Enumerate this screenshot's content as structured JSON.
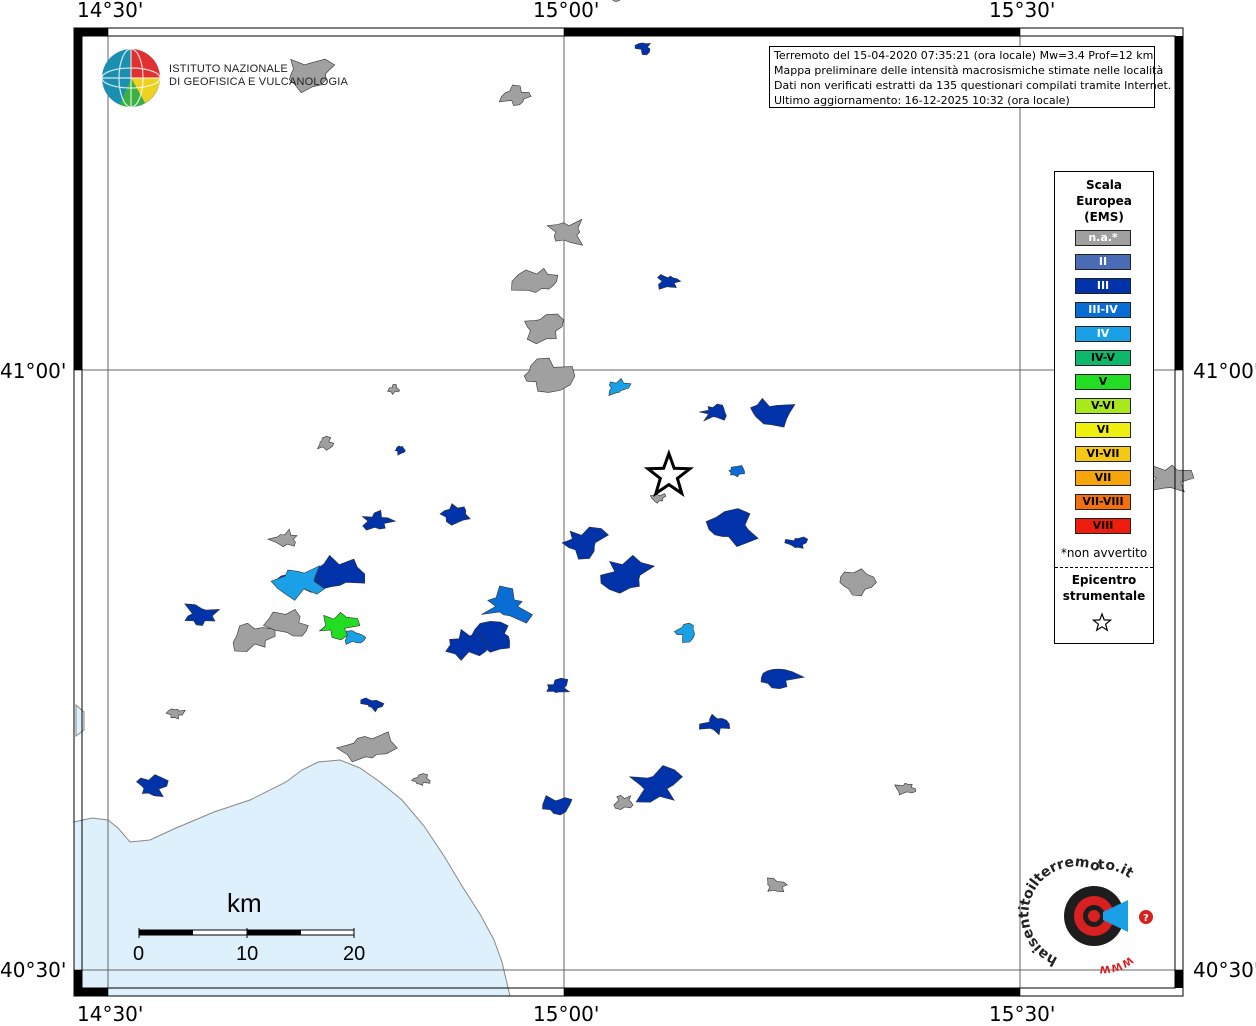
{
  "info": {
    "line1": "Terremoto del 15-04-2020 07:35:21 (ora locale) Mw=3.4 Prof=12 km",
    "line2": "Mappa preliminare delle intensità macrosismiche stimate nelle località",
    "line3": "Dati non verificati estratti da 135 questionari compilati tramite Internet.",
    "line4": "Ultimo aggiornamento: 16-12-2025 10:32 (ora locale)"
  },
  "axes": {
    "lon_labels": [
      "14°30'",
      "15°00'",
      "15°30'"
    ],
    "lat_labels": [
      "41°00'",
      "40°30'"
    ]
  },
  "legend": {
    "title_1": "Scala",
    "title_2": "Europea",
    "title_3": "(EMS)",
    "classes": [
      {
        "label": "n.a.*",
        "color": "#a0a0a0",
        "text_color": "#ffffff"
      },
      {
        "label": "II",
        "color": "#4a6bb5",
        "text_color": "#ffffff"
      },
      {
        "label": "III",
        "color": "#0033aa",
        "text_color": "#ffffff"
      },
      {
        "label": "III-IV",
        "color": "#0a6dd6",
        "text_color": "#ffffff"
      },
      {
        "label": "IV",
        "color": "#1aa0e6",
        "text_color": "#ffffff"
      },
      {
        "label": "IV-V",
        "color": "#0db86a",
        "text_color": "#000000"
      },
      {
        "label": "V",
        "color": "#22dd22",
        "text_color": "#000000"
      },
      {
        "label": "V-VI",
        "color": "#a8e81c",
        "text_color": "#000000"
      },
      {
        "label": "VI",
        "color": "#f0f010",
        "text_color": "#000000"
      },
      {
        "label": "VI-VII",
        "color": "#f5c816",
        "text_color": "#000000"
      },
      {
        "label": "VII",
        "color": "#f6a50c",
        "text_color": "#000000"
      },
      {
        "label": "VII-VIII",
        "color": "#f2700e",
        "text_color": "#000000"
      },
      {
        "label": "VIII",
        "color": "#ee1c0c",
        "text_color": "#000000"
      }
    ],
    "note": "*non avvertito",
    "epicenter_1": "Epicentro",
    "epicenter_2": "strumentale"
  },
  "logo": {
    "line1": "ISTITUTO NAZIONALE",
    "line2": "DI GEOFISICA E VULCANOLOGIA"
  },
  "scale_bar": {
    "unit": "km",
    "ticks": [
      "0",
      "10",
      "20"
    ]
  },
  "hsit_logo": {
    "text": "haisentitoilterremoto.it",
    "url": "WWW."
  },
  "colors": {
    "sea": "#ddf0fb",
    "frame": "#000000",
    "grid": "#555555"
  },
  "localities": [
    {
      "cls": 0,
      "lon": 14.948,
      "lat": 41.228
    },
    {
      "cls": 0,
      "lon": 15.054,
      "lat": 41.312
    },
    {
      "cls": 0,
      "lon": 15.003,
      "lat": 41.115
    },
    {
      "cls": 0,
      "lon": 14.976,
      "lat": 41.036
    },
    {
      "cls": 0,
      "lon": 14.719,
      "lat": 41.247
    },
    {
      "cls": 0,
      "lon": 14.977,
      "lat": 40.995
    },
    {
      "cls": 0,
      "lon": 14.814,
      "lat": 40.984
    },
    {
      "cls": 0,
      "lon": 14.737,
      "lat": 40.939
    },
    {
      "cls": 0,
      "lon": 14.695,
      "lat": 40.859
    },
    {
      "cls": 0,
      "lon": 14.575,
      "lat": 40.714
    },
    {
      "cls": 0,
      "lon": 15.104,
      "lat": 40.893
    },
    {
      "cls": 0,
      "lon": 15.321,
      "lat": 40.823
    },
    {
      "cls": 0,
      "lon": 15.383,
      "lat": 41.261
    },
    {
      "cls": 0,
      "lon": 15.662,
      "lat": 40.91
    },
    {
      "cls": 0,
      "lon": 15.232,
      "lat": 40.571
    },
    {
      "cls": 0,
      "lon": 15.376,
      "lat": 40.651
    },
    {
      "cls": 0,
      "lon": 14.843,
      "lat": 40.658
    },
    {
      "cls": 0,
      "lon": 14.786,
      "lat": 40.685
    },
    {
      "cls": 0,
      "lon": 14.658,
      "lat": 40.778
    },
    {
      "cls": 0,
      "lon": 14.699,
      "lat": 40.787
    },
    {
      "cls": 0,
      "lon": 14.973,
      "lat": 41.074
    },
    {
      "cls": 0,
      "lon": 15.065,
      "lat": 40.64
    },
    {
      "cls": 2,
      "lon": 15.088,
      "lat": 41.268
    },
    {
      "cls": 2,
      "lon": 15.115,
      "lat": 41.074
    },
    {
      "cls": 2,
      "lon": 14.82,
      "lat": 40.934
    },
    {
      "cls": 2,
      "lon": 14.881,
      "lat": 40.88
    },
    {
      "cls": 2,
      "lon": 14.795,
      "lat": 40.874
    },
    {
      "cls": 2,
      "lon": 14.753,
      "lat": 40.829
    },
    {
      "cls": 2,
      "lon": 14.75,
      "lat": 40.83
    },
    {
      "cls": 2,
      "lon": 14.6,
      "lat": 40.795
    },
    {
      "cls": 2,
      "lon": 14.79,
      "lat": 40.722
    },
    {
      "cls": 2,
      "lon": 15.022,
      "lat": 40.856
    },
    {
      "cls": 2,
      "lon": 15.183,
      "lat": 40.867
    },
    {
      "cls": 2,
      "lon": 15.255,
      "lat": 40.856
    },
    {
      "cls": 2,
      "lon": 14.925,
      "lat": 40.778
    },
    {
      "cls": 2,
      "lon": 15.232,
      "lat": 40.744
    },
    {
      "cls": 2,
      "lon": 14.993,
      "lat": 40.735
    },
    {
      "cls": 2,
      "lon": 14.547,
      "lat": 40.653
    },
    {
      "cls": 2,
      "lon": 14.992,
      "lat": 40.638
    },
    {
      "cls": 2,
      "lon": 15.101,
      "lat": 40.654
    },
    {
      "cls": 2,
      "lon": 15.166,
      "lat": 40.705
    },
    {
      "cls": 2,
      "lon": 15.223,
      "lat": 40.964
    },
    {
      "cls": 2,
      "lon": 15.165,
      "lat": 40.965
    },
    {
      "cls": 2,
      "lon": 15.068,
      "lat": 40.829
    },
    {
      "cls": 2,
      "lon": 14.708,
      "lat": 40.824
    },
    {
      "cls": 2,
      "lon": 14.893,
      "lat": 40.771
    },
    {
      "cls": 3,
      "lon": 15.188,
      "lat": 40.916
    },
    {
      "cls": 3,
      "lon": 14.937,
      "lat": 40.803
    },
    {
      "cls": 4,
      "lon": 14.77,
      "lat": 40.777
    },
    {
      "cls": 4,
      "lon": 15.059,
      "lat": 40.985
    },
    {
      "cls": 4,
      "lon": 14.712,
      "lat": 40.824
    },
    {
      "cls": 4,
      "lon": 15.134,
      "lat": 40.782
    },
    {
      "cls": 6,
      "lon": 14.75,
      "lat": 40.787
    }
  ],
  "epicenter": {
    "lon": 15.115,
    "lat": 40.912
  }
}
